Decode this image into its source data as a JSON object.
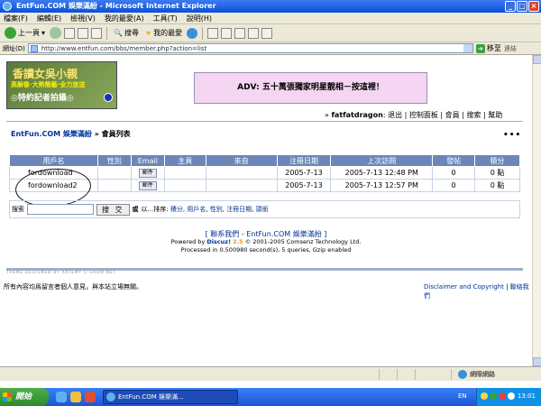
{
  "window": {
    "title": "EntFun.COM 娛樂滿紛 - Microsoft Internet Explorer"
  },
  "menu": [
    "檔案(F)",
    "編輯(E)",
    "檢視(V)",
    "我的最愛(A)",
    "工具(T)",
    "說明(H)"
  ],
  "toolbar": {
    "back_label": "上一頁",
    "search_label": "搜尋",
    "favorites_label": "我的最愛"
  },
  "address": {
    "label": "網址(D)",
    "url": "http://www.entfun.com/bbs/member.php?action=list",
    "go_label": "移至",
    "links_label": "連結"
  },
  "banner": {
    "logo_line1": "香讀女吳小親",
    "logo_line2": "高解像·大熱簡藝·全力放送",
    "logo_line3": "◎特約記者拍攝◎",
    "adv_text": "ADV: 五十萬張獨家明星靚相－按這裡！"
  },
  "userbar": {
    "prefix": "» ",
    "username": "fatfatdragon",
    "links": [
      "退出",
      "控制面板",
      "會員",
      "搜索",
      "幫助"
    ]
  },
  "breadcrumb": {
    "site": "EntFun.COM 娛樂滿紛",
    "separator": " » ",
    "current": "會員列表"
  },
  "more_dots": "•••",
  "table": {
    "headers": [
      "用戶名",
      "性別",
      "Email",
      "主頁",
      "來自",
      "注冊日期",
      "上次訪問",
      "發帖",
      "積分"
    ],
    "rows": [
      {
        "name": "fordownload",
        "gender": "",
        "email": "郵件",
        "homepage": "",
        "from": "",
        "regdate": "2005-7-13",
        "lastvisit": "2005-7-13 12:48 PM",
        "posts": "0",
        "credits": "0 點"
      },
      {
        "name": "fordownload2",
        "gender": "",
        "email": "郵件",
        "homepage": "",
        "from": "",
        "regdate": "2005-7-13",
        "lastvisit": "2005-7-13 12:57 PM",
        "posts": "0",
        "credits": "0 點"
      }
    ]
  },
  "search": {
    "label": "搜索",
    "button": "搜 交",
    "or_label": "或",
    "sort_prefix": "以...排序:",
    "sort_links": [
      "積分",
      "用戶名",
      "性別",
      "注冊日期",
      "頭銜"
    ]
  },
  "footer": {
    "contact": "[ 聯系我們 - EntFun.COM 娛樂滿紛 ]",
    "powered_prefix": "Powered by ",
    "powered_name": "Discuz!",
    "powered_version": "2.5",
    "powered_suffix": " © 2001-2005 Comsenz Technology Ltd.",
    "processed": "Processed in 0.500980 second(s), 5 queries, Gzip enabled",
    "theme_credit": "THEME DESIGNED BY ARTEMY C-SHOW.NET"
  },
  "bottom": {
    "disclaimer_left": "所有內容均爲留言者個人意見，與本站立場無關。",
    "disclaimer_link": "Disclaimer and Copyright",
    "contact_link": "聯絡我們"
  },
  "statusbar": {
    "zone": "網際網路"
  },
  "taskbar": {
    "start": "開始",
    "task_title": "EntFun.COM 娛樂滿...",
    "lang": "EN",
    "clock": "13:01"
  },
  "colors": {
    "header_blue": "#6b86b9",
    "link_blue": "#003399",
    "adv_pink": "#f5d6f2"
  }
}
